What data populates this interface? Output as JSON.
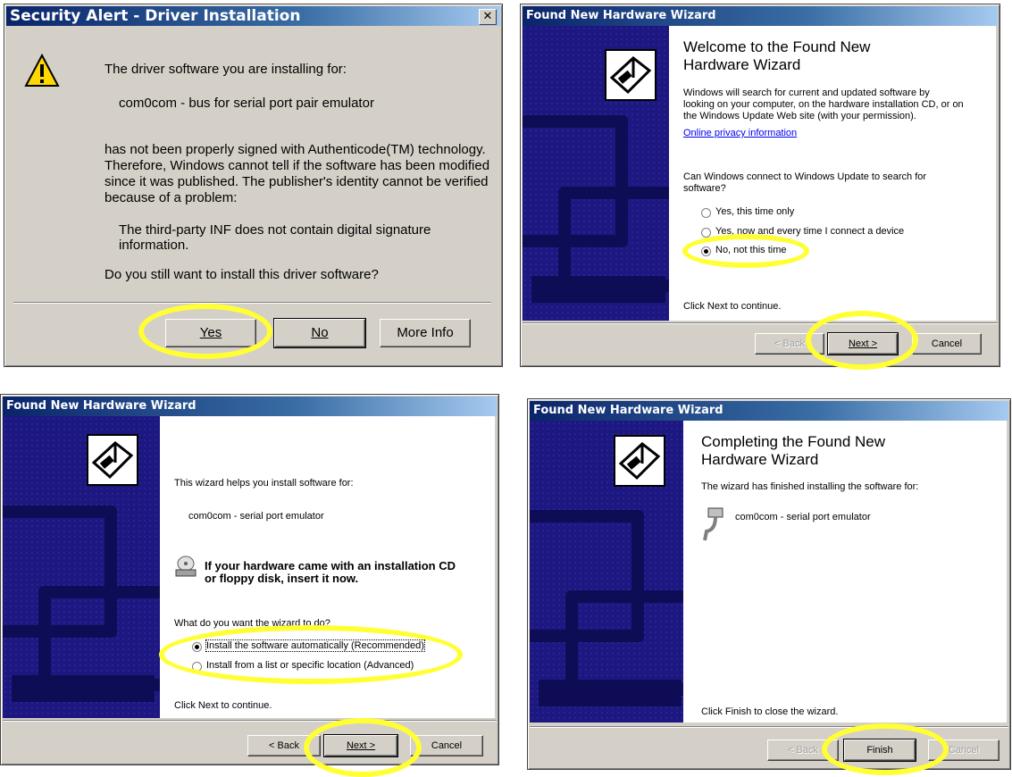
{
  "security": {
    "title": "Security Alert - Driver Installation",
    "line1": "The driver software you are installing for:",
    "device": "com0com - bus for serial port pair emulator",
    "body1": "has not been properly signed with Authenticode(TM) technology.",
    "body2": "Therefore, Windows cannot tell if the software has been modified",
    "body3": "since it was published. The publisher's identity cannot be verified",
    "body4": "because of a problem:",
    "problem": "The third-party INF does not contain digital signature information.",
    "question": "Do you still want to install this driver software?",
    "yes": "Yes",
    "no": "No",
    "more": "More Info"
  },
  "welcome": {
    "title": "Found New Hardware Wizard",
    "heading1": "Welcome to the Found New",
    "heading2": "Hardware Wizard",
    "p1": "Windows will search for current and updated software by",
    "p2": "looking on your computer, on the hardware installation CD, or on",
    "p3": "the Windows Update Web site (with your permission).",
    "privacy": "Online privacy information",
    "q1": "Can Windows connect to Windows Update to search for",
    "q2": "software?",
    "opt1": "Yes, this time only",
    "opt2": "Yes, now and every time I connect a device",
    "opt3": "No, not this time",
    "cont": "Click Next to continue.",
    "back": "< Back",
    "next": "Next >",
    "cancel": "Cancel"
  },
  "install": {
    "title": "Found New Hardware Wizard",
    "line1": "This wizard helps you install software for:",
    "device": "com0com - serial port emulator",
    "cd1": "If your hardware came with an installation CD",
    "cd2": "or floppy disk, insert it now.",
    "question": "What do you want the wizard to do?",
    "opt1": "Install the software automatically (Recommended)",
    "opt2": "Install from a list or specific location (Advanced)",
    "cont": "Click Next to continue.",
    "back": "< Back",
    "next": "Next >",
    "cancel": "Cancel"
  },
  "complete": {
    "title": "Found New Hardware Wizard",
    "heading1": "Completing the Found New",
    "heading2": "Hardware Wizard",
    "line1": "The wizard has finished installing the software for:",
    "device": "com0com - serial port emulator",
    "close": "Click Finish to close the wizard.",
    "back": "< Back",
    "finish": "Finish",
    "cancel": "Cancel"
  },
  "colors": {
    "highlight": "#ffff33",
    "wizard_panel": "#1d1880",
    "titlebar": "#0a246a"
  }
}
